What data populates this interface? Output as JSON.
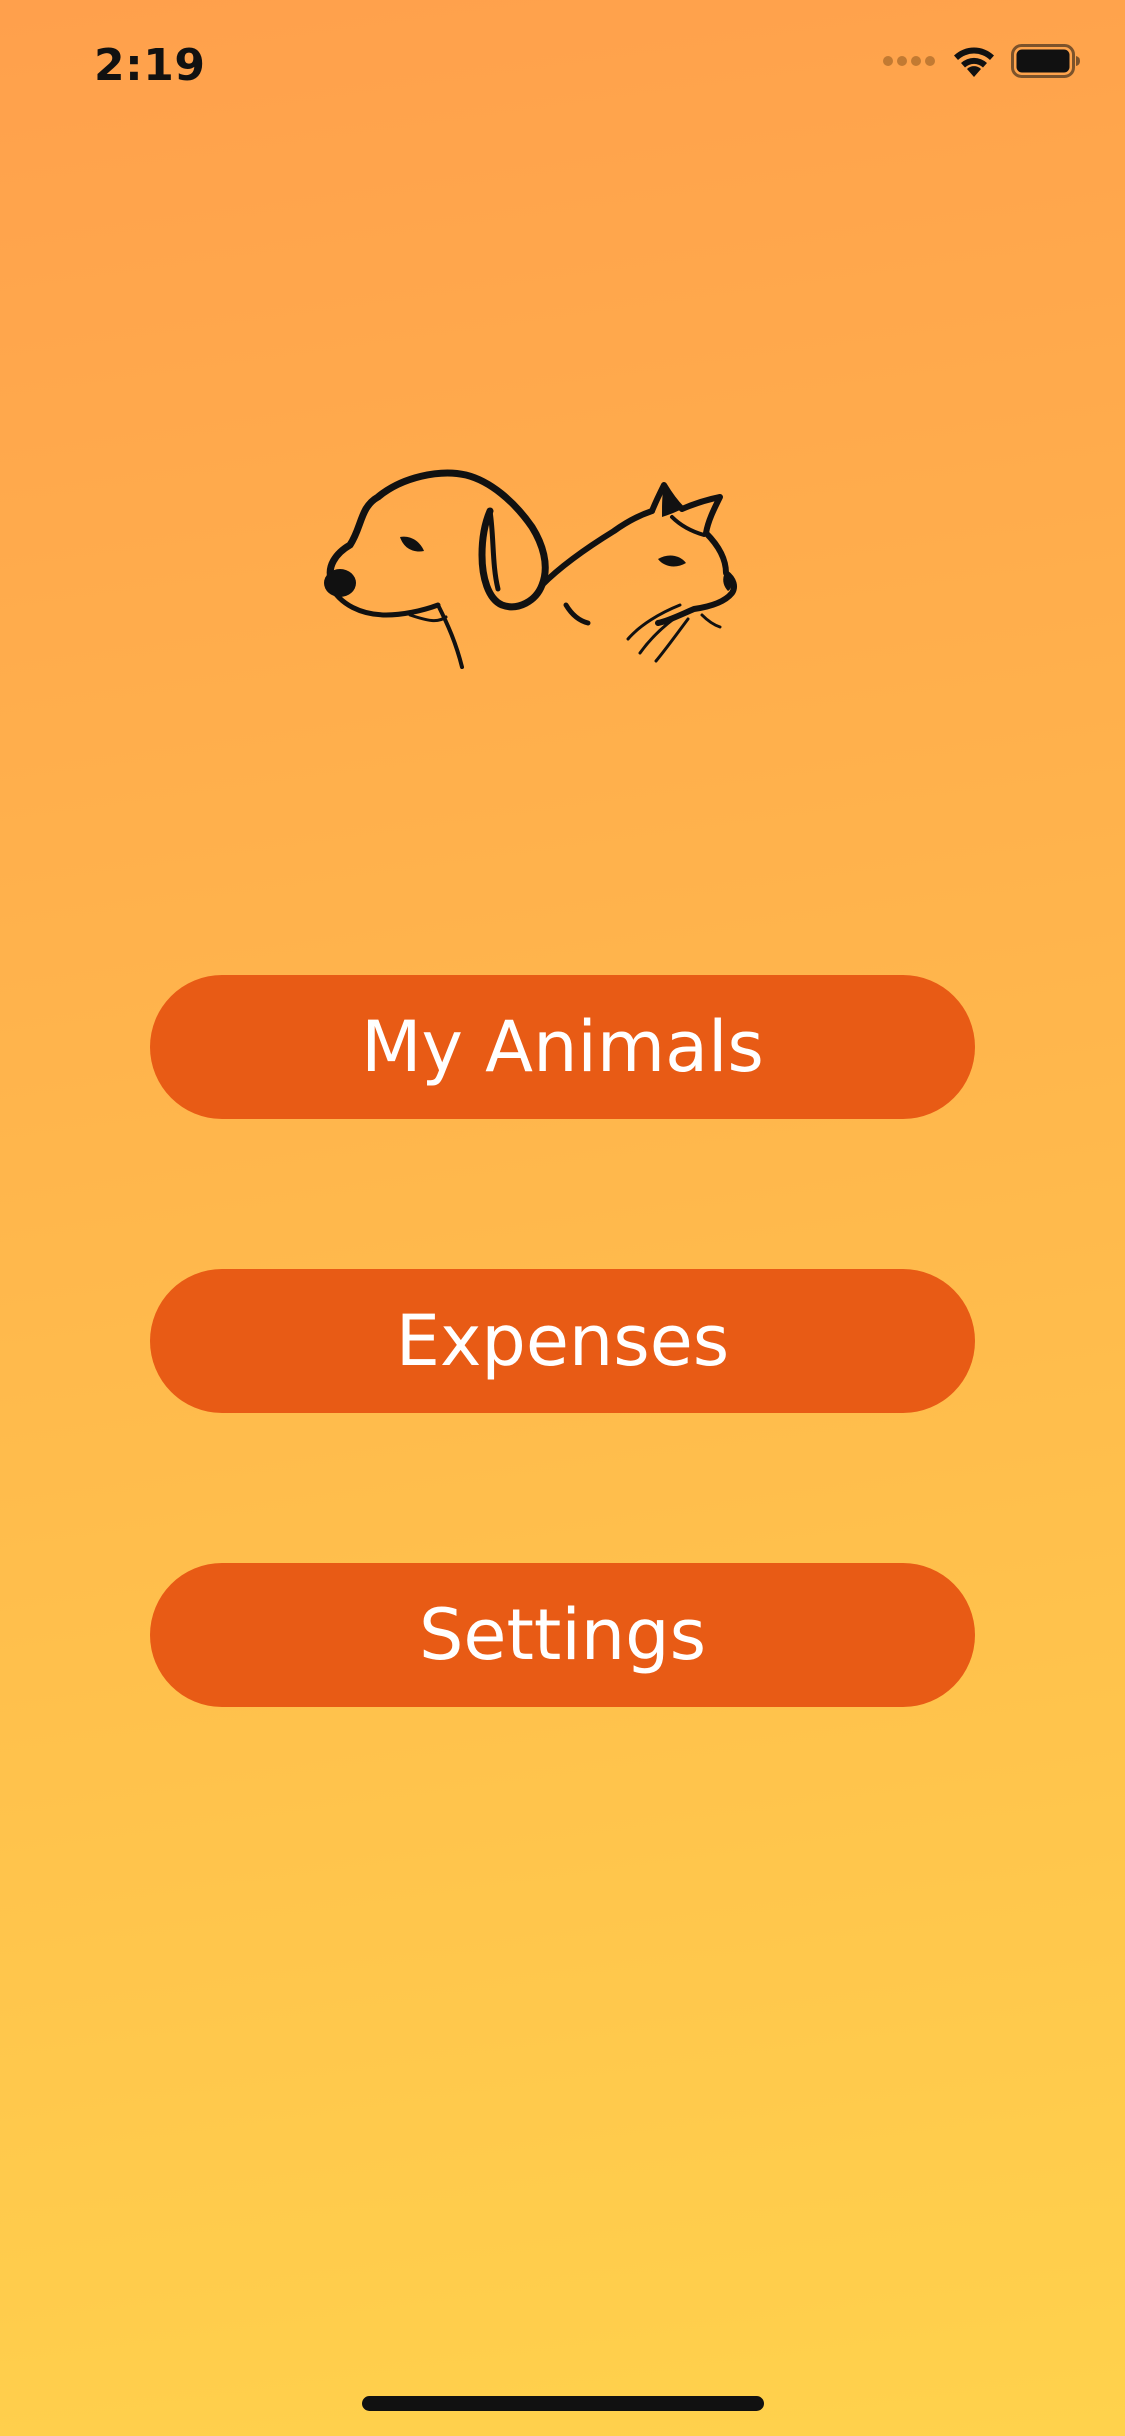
{
  "status_bar": {
    "time": "2:19",
    "icons": [
      "cellular-signal-icon",
      "wifi-icon",
      "battery-icon"
    ]
  },
  "logo": {
    "icon": "dog-and-cat-logo"
  },
  "menu": {
    "items": [
      {
        "label": "My Animals"
      },
      {
        "label": "Expenses"
      },
      {
        "label": "Settings"
      }
    ]
  },
  "colors": {
    "background_top": "#ffa04c",
    "background_bottom": "#ffd24c",
    "button": "#e85b15",
    "button_text": "#ffffff"
  }
}
